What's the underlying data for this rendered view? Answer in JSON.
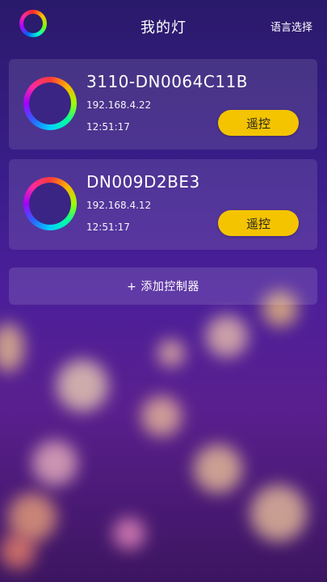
{
  "header": {
    "title": "我的灯",
    "language_button": "语言选择",
    "logo_icon": "color-ring-icon"
  },
  "devices": [
    {
      "name": "3110-DN0064C11B",
      "ip": "192.168.4.22",
      "time": "12:51:17",
      "button_label": "遥控",
      "icon": "color-ring-icon"
    },
    {
      "name": "DN009D2BE3",
      "ip": "192.168.4.12",
      "time": "12:51:17",
      "button_label": "遥控",
      "icon": "color-ring-icon"
    }
  ],
  "add_controller": {
    "label": "+ 添加控制器"
  },
  "colors": {
    "accent": "#f5c400",
    "background_top": "#2a1a6b",
    "background_bottom": "#5a1f8e"
  }
}
